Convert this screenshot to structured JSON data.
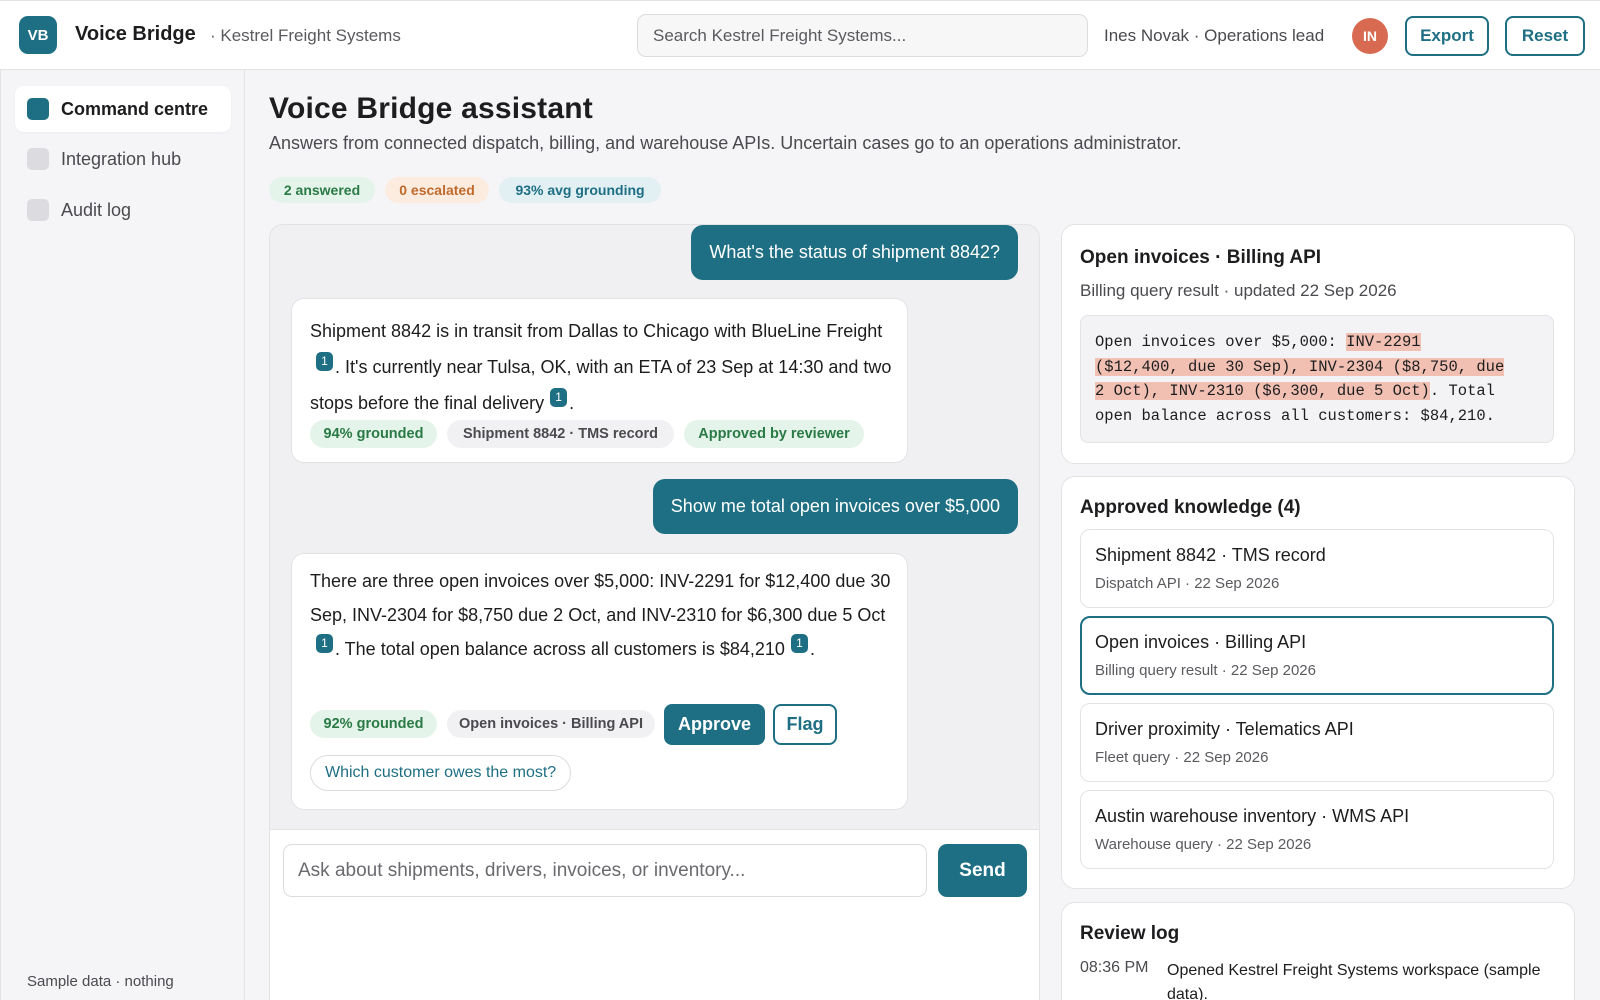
{
  "header": {
    "logo": "VB",
    "app_name": "Voice Bridge",
    "org_name": "· Kestrel Freight Systems",
    "search_placeholder": "Search Kestrel Freight Systems...",
    "user_label": "Ines Novak · Operations lead",
    "avatar_initials": "IN",
    "export_label": "Export",
    "reset_label": "Reset"
  },
  "sidebar": {
    "items": [
      {
        "label": "Command centre",
        "active": true
      },
      {
        "label": "Integration hub",
        "active": false
      },
      {
        "label": "Audit log",
        "active": false
      }
    ],
    "footer": "Sample data · nothing"
  },
  "main": {
    "title": "Voice Bridge assistant",
    "subtitle": "Answers from connected dispatch, billing, and warehouse APIs. Uncertain cases go to an operations administrator.",
    "stats": {
      "answered": "2 answered",
      "escalated": "0 escalated",
      "grounding": "93% avg grounding"
    }
  },
  "chat": {
    "messages": [
      {
        "role": "user",
        "text": "What's the status of shipment 8842?"
      },
      {
        "role": "assistant",
        "text_1": "Shipment 8842 is in transit from Dallas to Chicago with BlueLine Freight",
        "cite_1": "1",
        "text_2": ". It's currently near Tulsa, OK, with an ETA of 23 Sep at 14:30 and two stops before the final delivery",
        "cite_2": "1",
        "text_3": ".",
        "grounded": "94% grounded",
        "source": "Shipment 8842 · TMS record",
        "review": "Approved by reviewer"
      },
      {
        "role": "user",
        "text": "Show me total open invoices over $5,000"
      },
      {
        "role": "assistant",
        "text_1": "There are three open invoices over $5,000: INV-2291 for $12,400 due 30 Sep, INV-2304 for $8,750 due 2 Oct, and INV-2310 for $6,300 due 5 Oct",
        "cite_1": "1",
        "text_2": ". The total open balance across all customers is $84,210",
        "cite_2": "1",
        "text_3": ".",
        "grounded": "92% grounded",
        "source": "Open invoices · Billing API",
        "approve_label": "Approve",
        "flag_label": "Flag",
        "suggestion": "Which customer owes the most?"
      }
    ],
    "composer_placeholder": "Ask about shipments, drivers, invoices, or inventory...",
    "send_label": "Send"
  },
  "source_panel": {
    "title": "Open invoices · Billing API",
    "meta": "Billing query result · updated 22 Sep 2026",
    "code_pre": "Open invoices over $5,000: ",
    "code_hl_1": "INV-2291 ",
    "code_hl_2": "($12,400, due 30 Sep), INV-2304 ($8,750, due ",
    "code_hl_3": "2 Oct), INV-2310 ($6,300, due 5 Oct)",
    "code_post_1": ". Total",
    "code_post_2": "open balance across all customers: $84,210."
  },
  "knowledge": {
    "title": "Approved knowledge (4)",
    "items": [
      {
        "title": "Shipment 8842 · TMS record",
        "meta": "Dispatch API · 22 Sep 2026"
      },
      {
        "title": "Open invoices · Billing API",
        "meta": "Billing query result · 22 Sep 2026"
      },
      {
        "title": "Driver proximity · Telematics API",
        "meta": "Fleet query · 22 Sep 2026"
      },
      {
        "title": "Austin warehouse inventory · WMS API",
        "meta": "Warehouse query · 22 Sep 2026"
      }
    ]
  },
  "review_log": {
    "title": "Review log",
    "entries": [
      {
        "time": "08:36 PM",
        "text": "Opened Kestrel Freight Systems workspace (sample data)."
      }
    ]
  },
  "colors": {
    "accent": "#1e6f84",
    "avatar": "#d96a52",
    "highlight": "#f2c0b3"
  }
}
